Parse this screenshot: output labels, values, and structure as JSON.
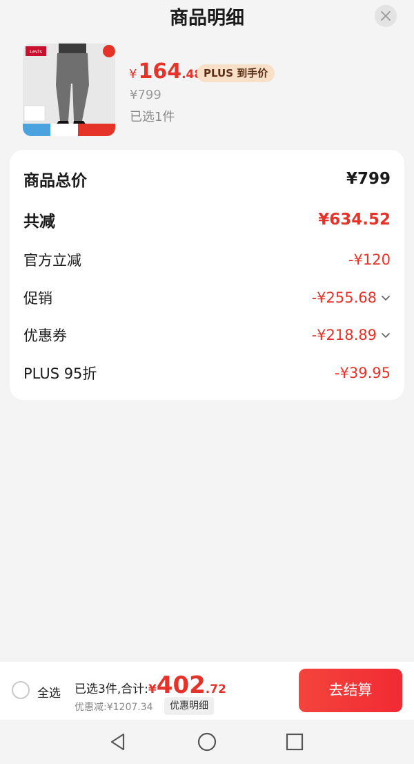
{
  "header": {
    "title": "商品明细"
  },
  "product": {
    "price_symbol": "¥",
    "price_int": "164",
    "price_dec": ".48",
    "plus_badge": "PLUS 到手价",
    "original_price": "¥799",
    "selected_count": "已选1件",
    "image_logo_text": "Levi's"
  },
  "summary": {
    "rows": [
      {
        "label": "商品总价",
        "value": "¥799"
      },
      {
        "label": "共减",
        "value": "¥634.52"
      },
      {
        "label": "官方立减",
        "value": "-¥120"
      },
      {
        "label": "促销",
        "value": "-¥255.68"
      },
      {
        "label": "优惠券",
        "value": "-¥218.89"
      },
      {
        "label": "PLUS 95折",
        "value": "-¥39.95"
      }
    ]
  },
  "bottom_bar": {
    "select_all": "全选",
    "total_label": "已选3件,合计:",
    "total_symbol": "¥",
    "total_int": "402",
    "total_dec": ".72",
    "discount_text": "优惠减:¥1207.34",
    "discount_detail": "优惠明细",
    "checkout": "去结算"
  },
  "colors": {
    "accent_red": "#e5332a",
    "plus_badge_bg": "#f8dfc8",
    "page_bg": "#f4f4f4"
  }
}
